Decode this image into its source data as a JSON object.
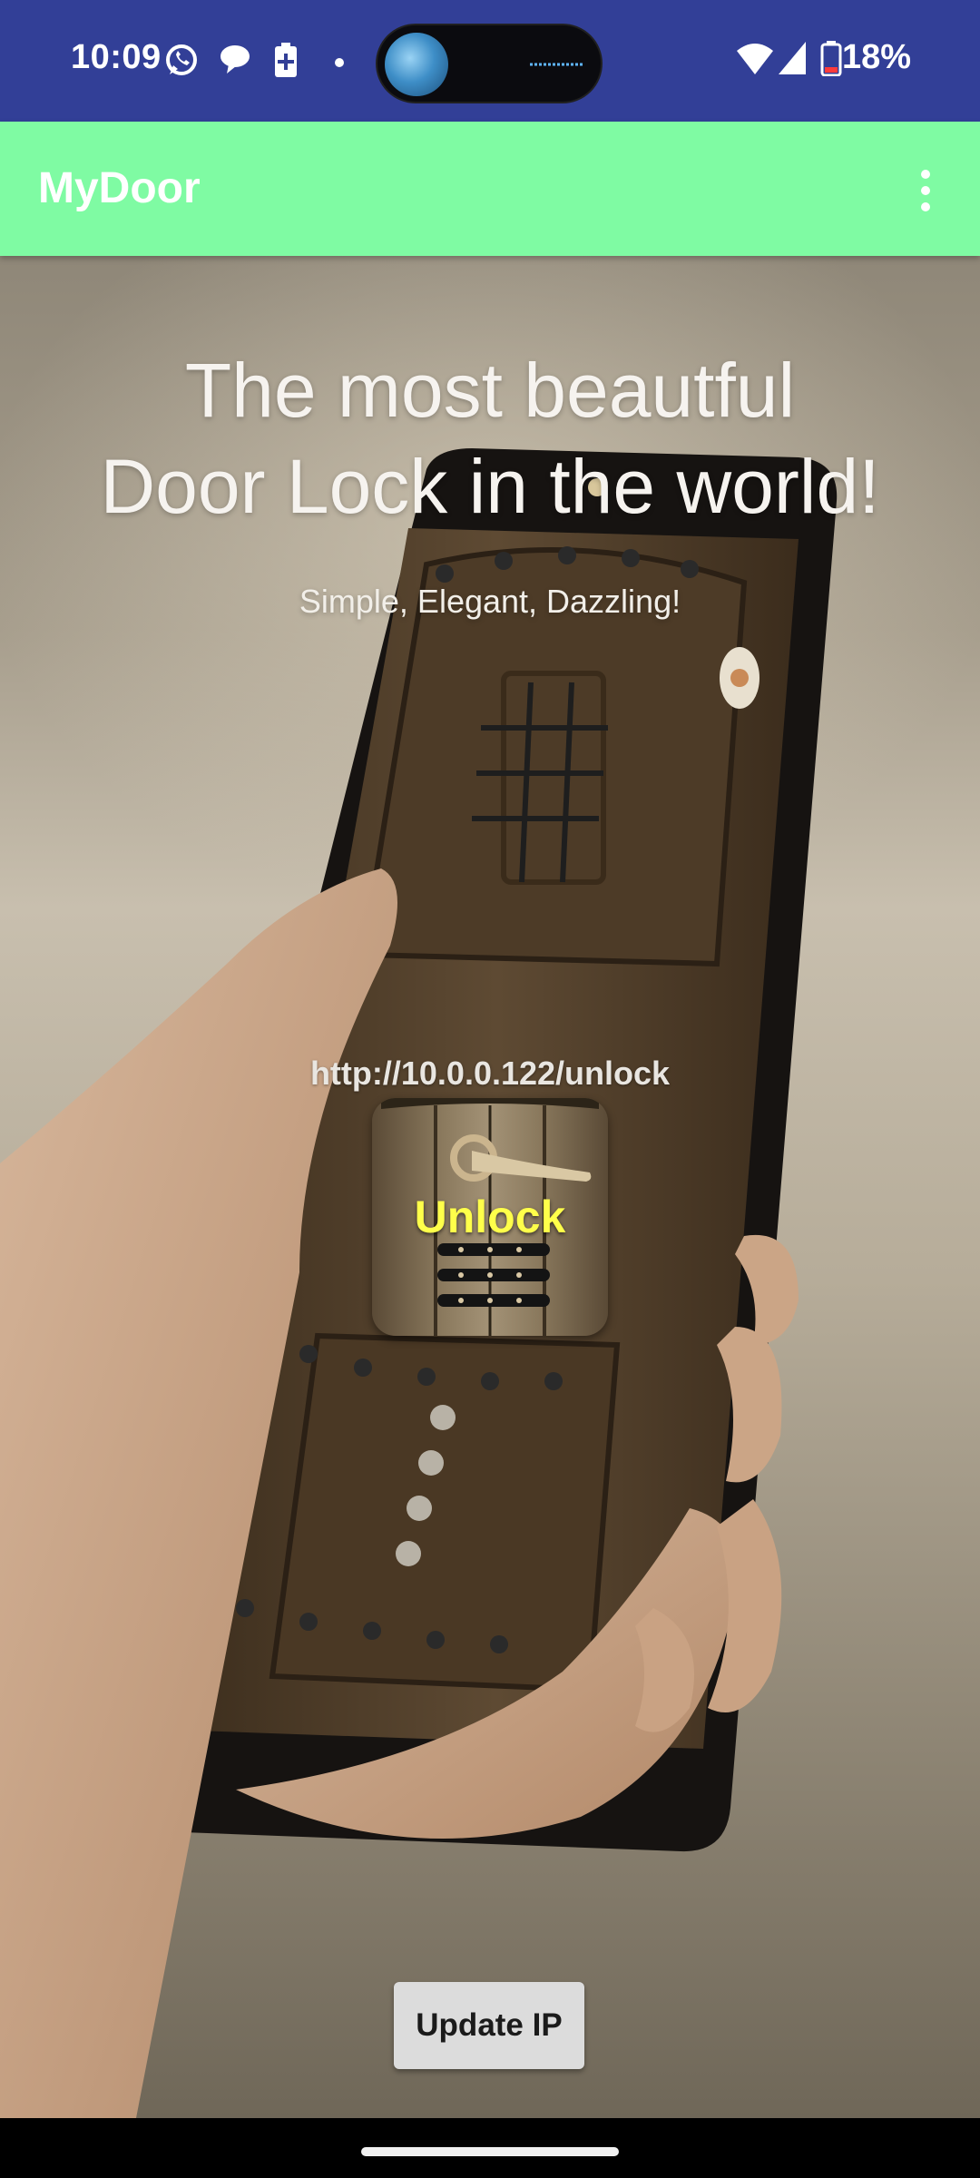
{
  "status_bar": {
    "time": "10:09",
    "battery_percent": "18%",
    "notification_icons": [
      "whatsapp-icon",
      "chat-bubble-icon",
      "battery-saver-icon",
      "dot-icon"
    ],
    "system_icons": [
      "wifi-icon",
      "signal-icon",
      "battery-icon"
    ]
  },
  "app_bar": {
    "title": "MyDoor",
    "accent_color": "#7ffba3",
    "overflow_icon": "more-vert-icon"
  },
  "hero": {
    "headline_line1": "The most beautful",
    "headline_line2": "Door Lock in the world!",
    "subheadline": "Simple, Elegant, Dazzling!"
  },
  "lock": {
    "url": "http://10.0.0.122/unlock",
    "unlock_label": "Unlock",
    "unlock_label_color": "#ffff4a"
  },
  "actions": {
    "update_ip_label": "Update IP"
  },
  "colors": {
    "status_bar": "#323f97"
  }
}
